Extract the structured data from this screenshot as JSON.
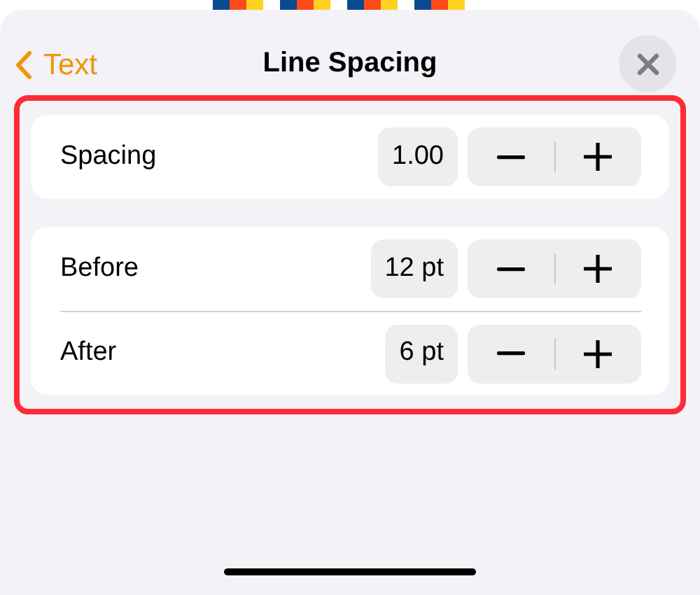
{
  "header": {
    "back_label": "Text",
    "title": "Line Spacing"
  },
  "highlighted": true,
  "groups": [
    {
      "rows": [
        {
          "label": "Spacing",
          "value": "1.00"
        }
      ]
    },
    {
      "rows": [
        {
          "label": "Before",
          "value": "12 pt"
        },
        {
          "label": "After",
          "value": "6 pt"
        }
      ]
    }
  ]
}
